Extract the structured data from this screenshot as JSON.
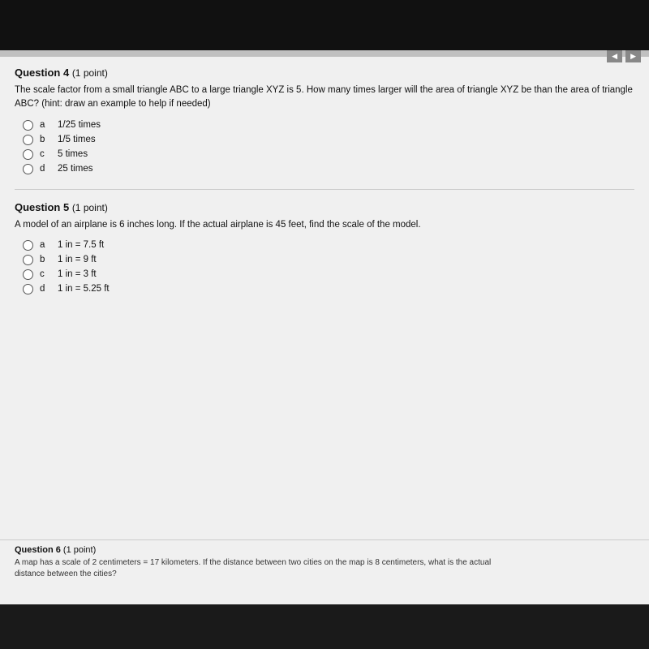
{
  "page": {
    "background": "#000",
    "nav_buttons": [
      "prev",
      "next"
    ]
  },
  "question4": {
    "title": "Question 4",
    "points": "(1 point)",
    "text": "The scale factor from a small triangle ABC to a large triangle XYZ is 5.  How many times larger will the area of triangle XYZ be than the area of triangle ABC? (hint: draw an example to help if needed)",
    "options": [
      {
        "label": "a",
        "value": "1/25 times"
      },
      {
        "label": "b",
        "value": "1/5 times"
      },
      {
        "label": "c",
        "value": "5 times"
      },
      {
        "label": "d",
        "value": "25 times"
      }
    ]
  },
  "question5": {
    "title": "Question 5",
    "points": "(1 point)",
    "text": "A model of an airplane is 6 inches long. If the actual airplane is 45 feet, find the scale of the model.",
    "options": [
      {
        "label": "a",
        "value": "1 in = 7.5 ft"
      },
      {
        "label": "b",
        "value": "1 in = 9 ft"
      },
      {
        "label": "c",
        "value": "1 in = 3 ft"
      },
      {
        "label": "d",
        "value": "1 in = 5.25 ft"
      }
    ]
  },
  "question6": {
    "title": "Question 6",
    "points": "(1 point)",
    "text_partial1": "A map has a scale of 2 centimeters = 17 kilometers. If the distance between two cities on the map is 8 centimeters, what is the actual",
    "text_partial2": "distance between the cities?"
  }
}
